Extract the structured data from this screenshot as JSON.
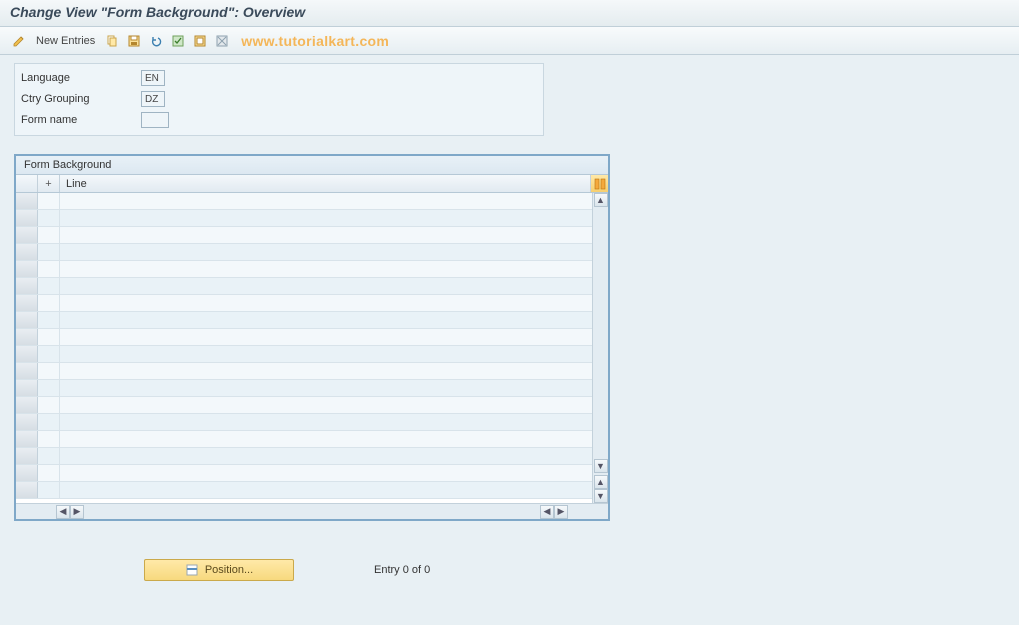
{
  "title": "Change View \"Form Background\": Overview",
  "toolbar": {
    "new_entries_label": "New Entries"
  },
  "watermark": "www.tutorialkart.com",
  "fields": {
    "language": {
      "label": "Language",
      "value": "EN"
    },
    "ctry_grouping": {
      "label": "Ctry Grouping",
      "value": "DZ"
    },
    "form_name": {
      "label": "Form name",
      "value": ""
    }
  },
  "table": {
    "title": "Form Background",
    "columns": {
      "plus": "+",
      "line": "Line"
    },
    "row_count": 18
  },
  "footer": {
    "position_label": "Position...",
    "entry_text": "Entry 0 of 0"
  }
}
